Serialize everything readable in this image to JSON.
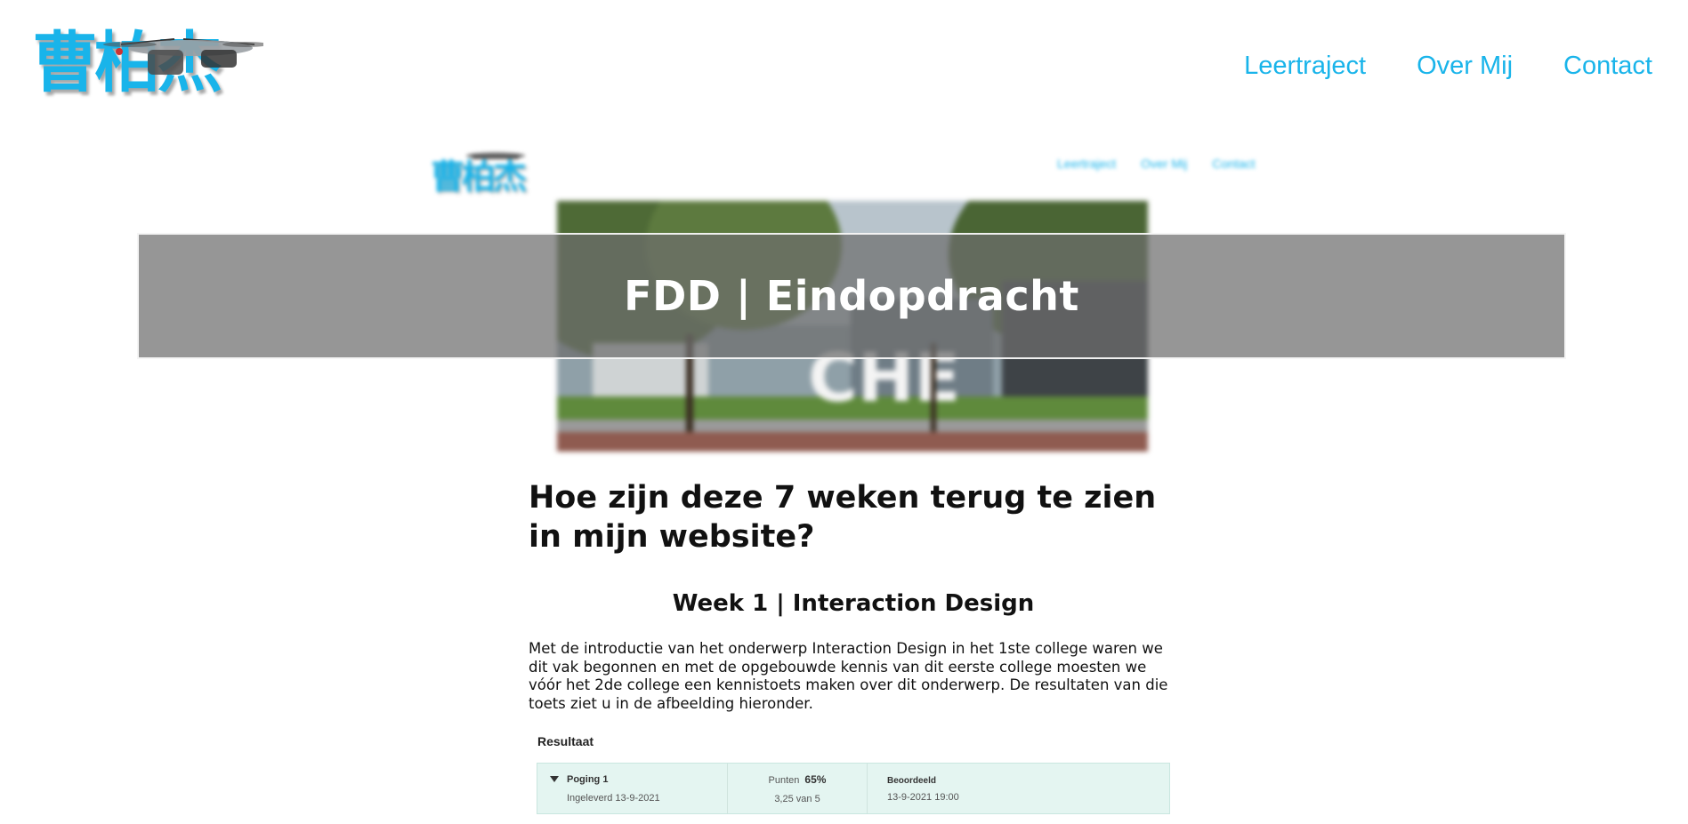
{
  "header": {
    "logo_text": "曹柏杰",
    "nav": [
      "Leertraject",
      "Over Mij",
      "Contact"
    ]
  },
  "preview": {
    "logo_text": "曹柏杰",
    "nav": [
      "Leertraject",
      "Over Mij",
      "Contact"
    ],
    "photo_sign": "CHE"
  },
  "banner": {
    "title": "FDD | Eindopdracht"
  },
  "content": {
    "heading": "Hoe zijn deze 7 weken terug te zien in mijn website?",
    "subheading": "Week 1 | Interaction Design",
    "paragraph": "Met de introductie van het onderwerp Interaction Design in het 1ste college waren we dit vak begonnen en met de opgebouwde kennis van dit eerste college moesten we vóór het 2de college een kennistoets maken over dit onderwerp. De resultaten van die toets ziet u in de afbeelding hieronder."
  },
  "result": {
    "label": "Resultaat",
    "attempt": "Poging 1",
    "submitted": "Ingeleverd 13-9-2021",
    "points_label": "Punten",
    "points_percent": "65%",
    "points_detail": "3,25 van 5",
    "graded_label": "Beoordeeld",
    "graded_date": "13-9-2021 19:00"
  },
  "colors": {
    "accent": "#19b4ea",
    "banner_bg": "#6e6e6e",
    "result_bg": "#e4f5f1"
  }
}
